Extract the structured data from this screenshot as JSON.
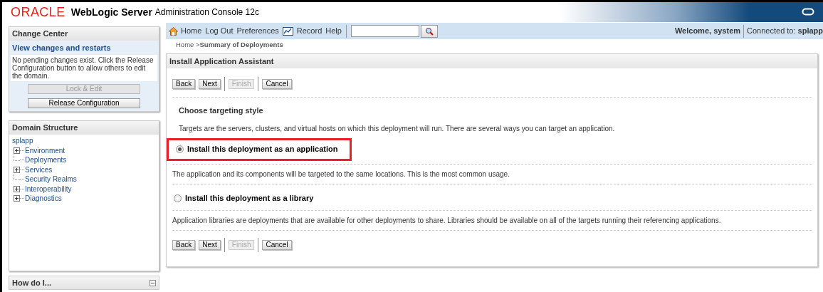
{
  "header": {
    "brand": "ORACLE",
    "product": "WebLogic Server",
    "subtitle": "Administration Console 12c"
  },
  "change_center": {
    "title": "Change Center",
    "link": "View changes and restarts",
    "message": "No pending changes exist. Click the Release Configuration button to allow others to edit the domain.",
    "buttons": [
      {
        "label": "Lock & Edit",
        "disabled": true
      },
      {
        "label": "Release Configuration",
        "disabled": false
      }
    ]
  },
  "domain_structure": {
    "title": "Domain Structure",
    "tree": {
      "label": "splapp",
      "children": [
        {
          "label": "Environment",
          "expandable": true
        },
        {
          "label": "Deployments",
          "expandable": false
        },
        {
          "label": "Services",
          "expandable": true
        },
        {
          "label": "Security Realms",
          "expandable": false
        },
        {
          "label": "Interoperability",
          "expandable": true
        },
        {
          "label": "Diagnostics",
          "expandable": true
        }
      ]
    }
  },
  "how_do_i": {
    "title": "How do I..."
  },
  "toolbar": {
    "links": [
      "Home",
      "Log Out",
      "Preferences",
      "Record",
      "Help"
    ],
    "welcome": "Welcome, system",
    "connected_label": "Connected to:",
    "connected_value": "splapp"
  },
  "breadcrumb": {
    "items": [
      "Home >"
    ],
    "current": "Summary of Deployments"
  },
  "assistant": {
    "title": "Install Application Assistant",
    "top_buttons": [
      {
        "label": "Back",
        "disabled": false
      },
      {
        "label": "Next",
        "disabled": false
      },
      {
        "label": "Finish",
        "disabled": true
      },
      {
        "label": "Cancel",
        "disabled": false
      }
    ],
    "heading": "Choose targeting style",
    "intro": "Targets are the servers, clusters, and virtual hosts on which this deployment will run. There are several ways you can target an application.",
    "options": [
      {
        "label": "Install this deployment as an application",
        "selected": true,
        "highlighted": true,
        "description": "The application and its components will be targeted to the same locations. This is the most common usage."
      },
      {
        "label": "Install this deployment as a library",
        "selected": false,
        "highlighted": false,
        "description": "Application libraries are deployments that are available for other deployments to share. Libraries should be available on all of the targets running their referencing applications."
      }
    ],
    "bottom_buttons": [
      {
        "label": "Back",
        "disabled": false
      },
      {
        "label": "Next",
        "disabled": false
      },
      {
        "label": "Finish",
        "disabled": true
      },
      {
        "label": "Cancel",
        "disabled": false
      }
    ]
  }
}
